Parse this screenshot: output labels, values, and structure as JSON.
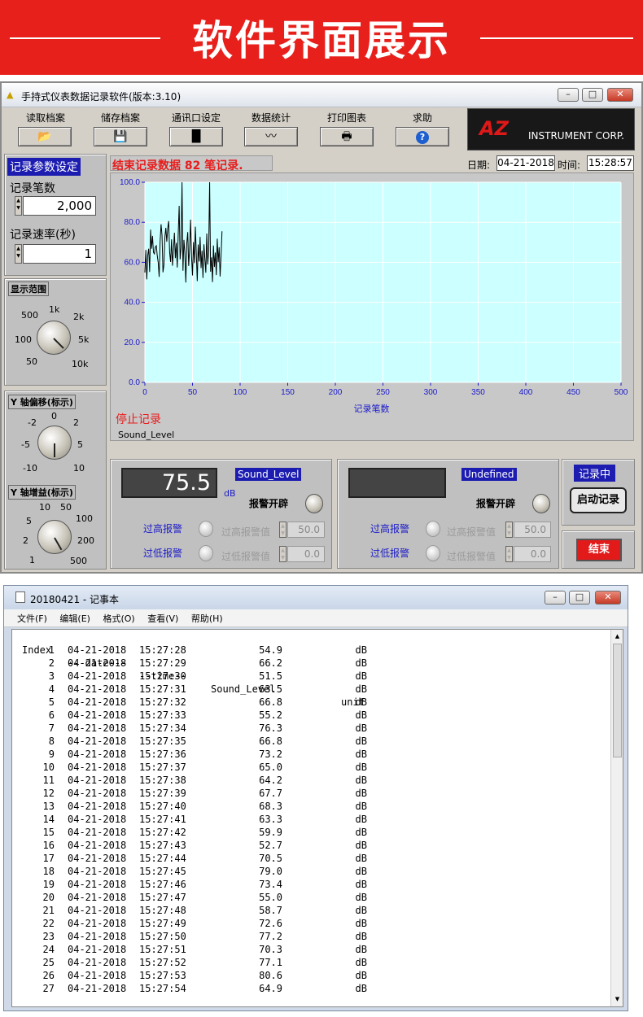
{
  "banner": {
    "title": "软件界面展示"
  },
  "app": {
    "title": "手持式仪表数据记录软件(版本:3.10)",
    "toolbar": [
      {
        "label": "读取档案",
        "icon": "open-folder-icon"
      },
      {
        "label": "储存档案",
        "icon": "floppy-disk-icon"
      },
      {
        "label": "通讯口设定",
        "icon": "port-icon"
      },
      {
        "label": "数据统计",
        "icon": "statistics-icon"
      },
      {
        "label": "打印图表",
        "icon": "printer-icon"
      },
      {
        "label": "求助",
        "icon": "help-icon"
      }
    ],
    "logo": {
      "brand": "AZ",
      "text": "INSTRUMENT CORP."
    },
    "status_message": "结束记录数据 82 笔记录.",
    "date_label": "日期:",
    "date_value": "04-21-2018",
    "time_label": "时间:",
    "time_value": "15:28:57",
    "params": {
      "header": "记录参数设定",
      "count_label": "记录笔数",
      "count_value": "2,000",
      "rate_label": "记录速率(秒)",
      "rate_value": "1"
    },
    "range": {
      "header": "显示范围",
      "ticks": [
        "500",
        "1k",
        "2k",
        "100",
        "5k",
        "50",
        "10k"
      ]
    },
    "yoffset": {
      "header": "Y 轴偏移(标示)",
      "ticks": [
        "-2",
        "0",
        "2",
        "-5",
        "5",
        "-10",
        "10"
      ]
    },
    "ygain": {
      "header": "Y 轴增益(标示)",
      "ticks": [
        "10",
        "50",
        "5",
        "100",
        "2",
        "200",
        "1",
        "500"
      ]
    },
    "chart_stop_label": "停止记录",
    "legend_label": "Sound_Level",
    "meter1": {
      "value": "75.5",
      "unit": "dB",
      "channel": "Sound_Level",
      "alarm_switch": "报警开辟",
      "high_alarm": "过高报警",
      "low_alarm": "过低报警",
      "high_value_label": "过高报警值",
      "low_value_label": "过低报警值",
      "high_value": "50.0",
      "low_value": "0.0"
    },
    "meter2": {
      "value": "",
      "channel": "Undefined",
      "alarm_switch": "报警开辟",
      "high_alarm": "过高报警",
      "low_alarm": "过低报警",
      "high_value_label": "过高报警值",
      "low_value_label": "过低报警值",
      "high_value": "50.0",
      "low_value": "0.0"
    },
    "recording_label": "记录中",
    "start_button": "启动记录",
    "end_button": "结束"
  },
  "chart_data": {
    "type": "line",
    "xlabel": "记录笔数",
    "ylabel": "",
    "xlim": [
      0,
      500
    ],
    "ylim": [
      0,
      100
    ],
    "x_ticks": [
      "0",
      "50",
      "100",
      "150",
      "200",
      "250",
      "300",
      "350",
      "400",
      "450",
      "500"
    ],
    "y_ticks": [
      "0.0",
      "20.0",
      "40.0",
      "60.0",
      "80.0",
      "100.0"
    ],
    "grid": true,
    "series": [
      {
        "name": "Sound_Level",
        "color": "#000000",
        "values": [
          54.9,
          66.2,
          51.5,
          63.5,
          66.8,
          55.2,
          76.3,
          66.8,
          73.2,
          65.0,
          64.2,
          67.7,
          68.3,
          63.3,
          59.9,
          52.7,
          70.5,
          79.0,
          73.4,
          55.0,
          58.7,
          72.6,
          77.2,
          70.3,
          77.1,
          80.6,
          64.9,
          60.2,
          71.5,
          58.3,
          66.0,
          74.8,
          62.1,
          69.7,
          57.4,
          73.9,
          88.2,
          61.5,
          67.3,
          100.0,
          55.8,
          71.2,
          64.6,
          49.9,
          69.4,
          75.1,
          58.2,
          66.7,
          81.3,
          62.8,
          53.4,
          70.1,
          59.6,
          77.8,
          64.3,
          50.6,
          68.9,
          60.4,
          72.7,
          57.1,
          65.8,
          52.2,
          69.0,
          61.7,
          54.8,
          74.4,
          58.9,
          66.1,
          100.0,
          55.3,
          62.5,
          50.1,
          68.4,
          57.7,
          64.9,
          53.6,
          71.8,
          60.0,
          67.5,
          52.9,
          63.2,
          75.5
        ]
      }
    ]
  },
  "notepad": {
    "title": "20180421 - 记事本",
    "menu": [
      "文件(F)",
      "编辑(E)",
      "格式(O)",
      "查看(V)",
      "帮助(H)"
    ],
    "headers": [
      "Index",
      "---date---",
      "--time--",
      "Sound_Level",
      "unit"
    ],
    "rows": [
      [
        "1",
        "04-21-2018",
        "15:27:28",
        "54.9",
        "dB"
      ],
      [
        "2",
        "04-21-2018",
        "15:27:29",
        "66.2",
        "dB"
      ],
      [
        "3",
        "04-21-2018",
        "15:27:30",
        "51.5",
        "dB"
      ],
      [
        "4",
        "04-21-2018",
        "15:27:31",
        "63.5",
        "dB"
      ],
      [
        "5",
        "04-21-2018",
        "15:27:32",
        "66.8",
        "dB"
      ],
      [
        "6",
        "04-21-2018",
        "15:27:33",
        "55.2",
        "dB"
      ],
      [
        "7",
        "04-21-2018",
        "15:27:34",
        "76.3",
        "dB"
      ],
      [
        "8",
        "04-21-2018",
        "15:27:35",
        "66.8",
        "dB"
      ],
      [
        "9",
        "04-21-2018",
        "15:27:36",
        "73.2",
        "dB"
      ],
      [
        "10",
        "04-21-2018",
        "15:27:37",
        "65.0",
        "dB"
      ],
      [
        "11",
        "04-21-2018",
        "15:27:38",
        "64.2",
        "dB"
      ],
      [
        "12",
        "04-21-2018",
        "15:27:39",
        "67.7",
        "dB"
      ],
      [
        "13",
        "04-21-2018",
        "15:27:40",
        "68.3",
        "dB"
      ],
      [
        "14",
        "04-21-2018",
        "15:27:41",
        "63.3",
        "dB"
      ],
      [
        "15",
        "04-21-2018",
        "15:27:42",
        "59.9",
        "dB"
      ],
      [
        "16",
        "04-21-2018",
        "15:27:43",
        "52.7",
        "dB"
      ],
      [
        "17",
        "04-21-2018",
        "15:27:44",
        "70.5",
        "dB"
      ],
      [
        "18",
        "04-21-2018",
        "15:27:45",
        "79.0",
        "dB"
      ],
      [
        "19",
        "04-21-2018",
        "15:27:46",
        "73.4",
        "dB"
      ],
      [
        "20",
        "04-21-2018",
        "15:27:47",
        "55.0",
        "dB"
      ],
      [
        "21",
        "04-21-2018",
        "15:27:48",
        "58.7",
        "dB"
      ],
      [
        "22",
        "04-21-2018",
        "15:27:49",
        "72.6",
        "dB"
      ],
      [
        "23",
        "04-21-2018",
        "15:27:50",
        "77.2",
        "dB"
      ],
      [
        "24",
        "04-21-2018",
        "15:27:51",
        "70.3",
        "dB"
      ],
      [
        "25",
        "04-21-2018",
        "15:27:52",
        "77.1",
        "dB"
      ],
      [
        "26",
        "04-21-2018",
        "15:27:53",
        "80.6",
        "dB"
      ],
      [
        "27",
        "04-21-2018",
        "15:27:54",
        "64.9",
        "dB"
      ]
    ]
  }
}
